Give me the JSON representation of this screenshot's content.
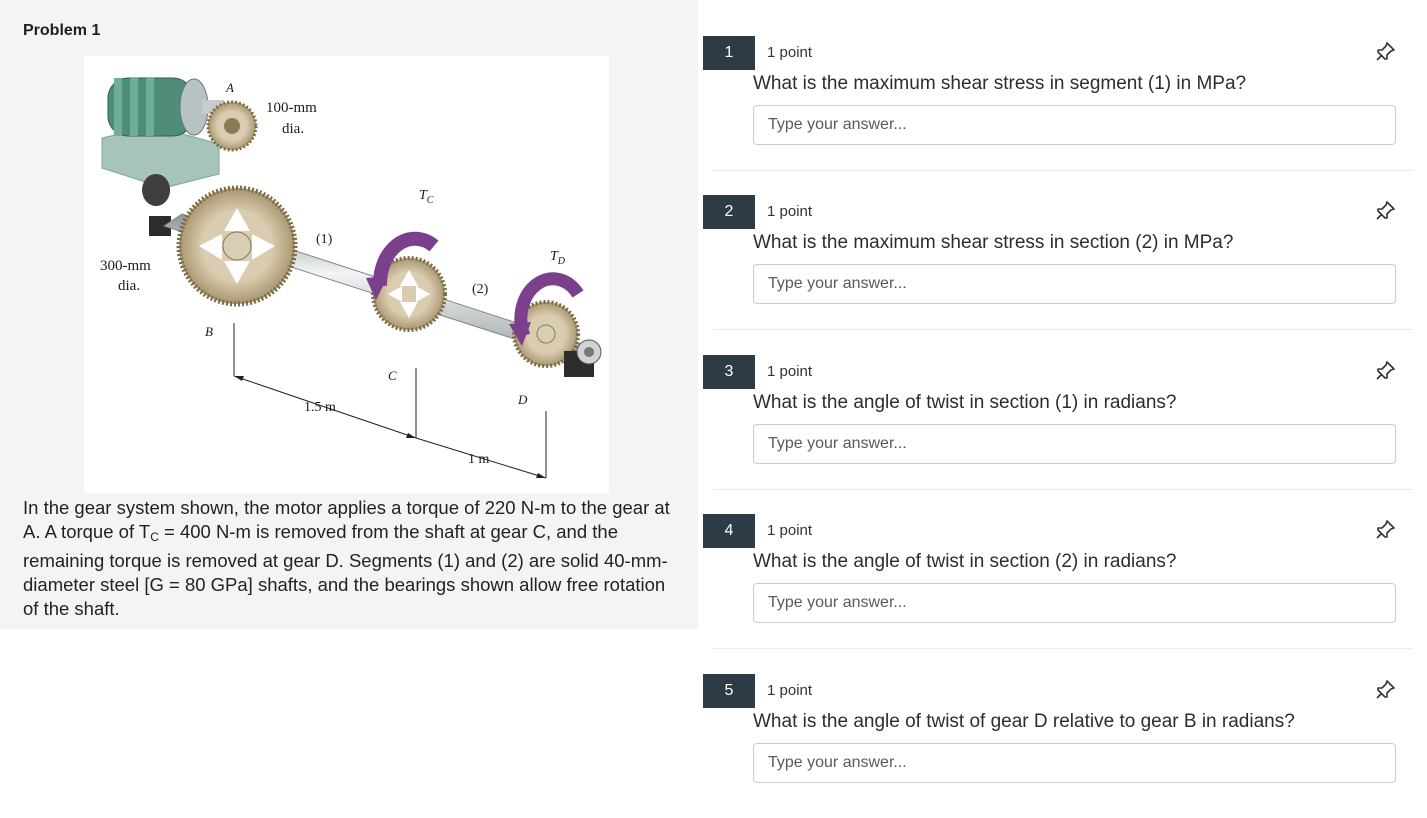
{
  "problem": {
    "title": "Problem 1",
    "description_parts": {
      "p1": "In the gear system shown, the motor applies a torque of 220 N-m to the gear at A. A torque of T",
      "sub": "C",
      "p2": " = 400 N-m is removed from the shaft at gear C, and the remaining torque is removed at gear D. Segments (1) and (2) are solid 40-mm-diameter steel [G = 80 GPa] shafts, and the bearings shown allow free rotation of the shaft."
    },
    "figure": {
      "label_a": "A",
      "label_100": "100-mm",
      "label_dia1": "dia.",
      "label_tc": "T",
      "label_tc_sub": "C",
      "label_seg1": "(1)",
      "label_td": "T",
      "label_td_sub": "D",
      "label_300": "300-mm",
      "label_dia2": "dia.",
      "label_seg2": "(2)",
      "label_b": "B",
      "label_c": "C",
      "label_d": "D",
      "label_15m": "1.5 m",
      "label_1m": "1 m"
    }
  },
  "questions": [
    {
      "number": "1",
      "points": "1 point",
      "text": "What is the maximum shear stress in segment (1) in MPa?",
      "placeholder": "Type your answer..."
    },
    {
      "number": "2",
      "points": "1 point",
      "text": "What is the maximum shear stress in section (2) in MPa?",
      "placeholder": "Type your answer..."
    },
    {
      "number": "3",
      "points": "1 point",
      "text": "What is the angle of twist in section (1) in radians?",
      "placeholder": "Type your answer..."
    },
    {
      "number": "4",
      "points": "1 point",
      "text": "What is the angle of twist in section (2) in radians?",
      "placeholder": "Type your answer..."
    },
    {
      "number": "5",
      "points": "1 point",
      "text": "What is the angle of twist of gear D relative to gear B in radians?",
      "placeholder": "Type your answer..."
    }
  ],
  "colors": {
    "number_badge": "#2d3b45",
    "panel_bg": "#f4f4f4",
    "torque_arrow": "#7b3f8c",
    "motor": "#4f8d7a",
    "gear": "#c9b999"
  },
  "icons": {
    "pin": "pin-icon"
  }
}
